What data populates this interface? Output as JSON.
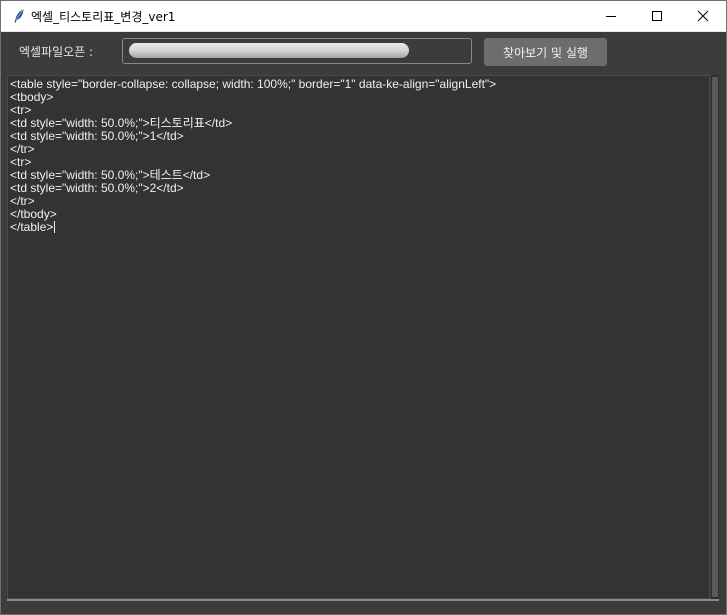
{
  "window": {
    "title": "엑셀_티스토리표_변경_ver1",
    "app_icon": "feather-icon",
    "controls": [
      "minimize-icon",
      "maximize-icon",
      "close-icon"
    ]
  },
  "toolbar": {
    "open_label": "엑셀파일오픈 :",
    "path_value": "",
    "run_button_label": "찾아보기 및 실행"
  },
  "editor": {
    "lines": [
      "<table style=\"border-collapse: collapse; width: 100%;\" border=\"1\" data-ke-align=\"alignLeft\">",
      "<tbody>",
      "<tr>",
      "<td style=\"width: 50.0%;\">티스토리표</td>",
      "<td style=\"width: 50.0%;\">1</td>",
      "</tr>",
      "<tr>",
      "<td style=\"width: 50.0%;\">테스트</td>",
      "<td style=\"width: 50.0%;\">2</td>",
      "</tr>",
      "</tbody>",
      "</table>"
    ]
  },
  "colors": {
    "background": "#3c3c3c",
    "editor_bg": "#333333",
    "button_bg": "#6d6d6d",
    "text": "#f0f0f0"
  }
}
